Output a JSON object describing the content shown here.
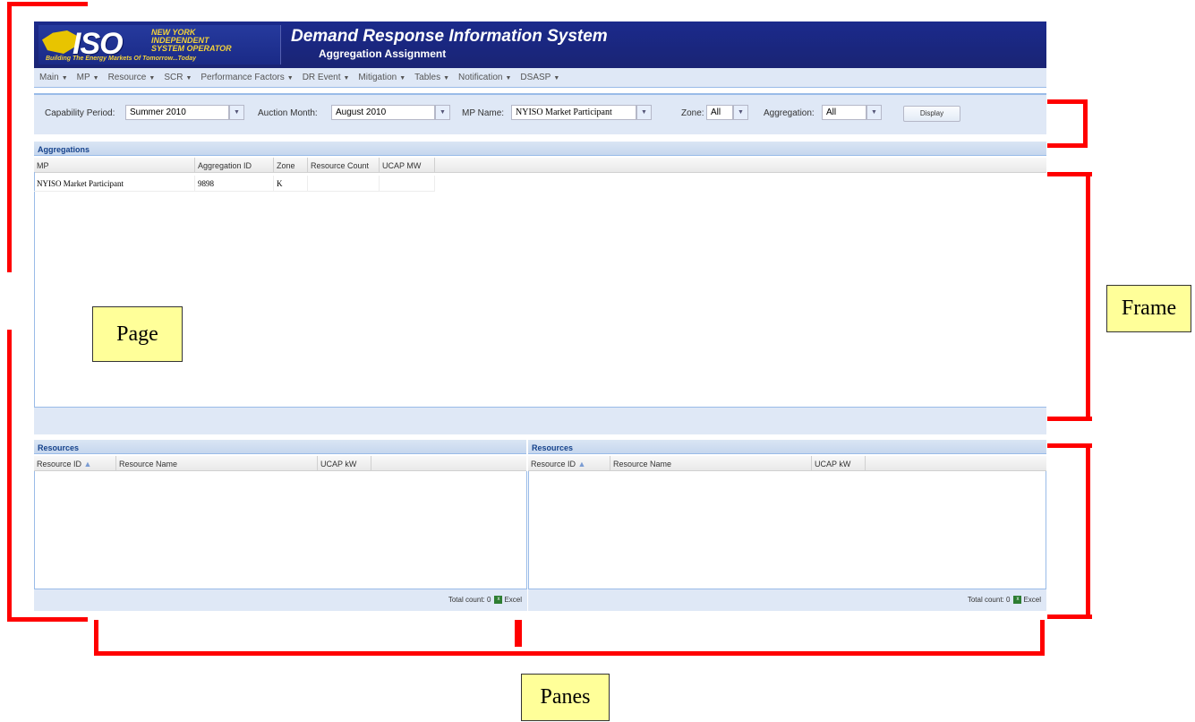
{
  "header": {
    "logo_text": "ISO",
    "logo_lines": "NEW YORK\nINDEPENDENT\nSYSTEM OPERATOR",
    "logo_tagline": "Building The Energy Markets Of Tomorrow...Today",
    "title": "Demand Response Information System",
    "subtitle": "Aggregation Assignment"
  },
  "menu": [
    "Main",
    "MP",
    "Resource",
    "SCR",
    "Performance Factors",
    "DR Event",
    "Mitigation",
    "Tables",
    "Notification",
    "DSASP"
  ],
  "filters": {
    "capability_period_label": "Capability Period:",
    "capability_period_value": "Summer 2010",
    "auction_month_label": "Auction Month:",
    "auction_month_value": "August 2010",
    "mp_name_label": "MP Name:",
    "mp_name_value": "NYISO Market Participant",
    "zone_label": "Zone:",
    "zone_value": "All",
    "aggregation_label": "Aggregation:",
    "aggregation_value": "All",
    "display_button": "Display"
  },
  "aggregations": {
    "title": "Aggregations",
    "columns": [
      "MP",
      "Aggregation ID",
      "Zone",
      "Resource Count",
      "UCAP MW"
    ],
    "rows": [
      [
        "NYISO Market Participant",
        "9898",
        "K",
        "",
        ""
      ]
    ]
  },
  "resources_left": {
    "title": "Resources",
    "columns": [
      "Resource ID",
      "Resource Name",
      "UCAP kW"
    ],
    "footer_count": "Total count: 0",
    "excel_label": "Excel"
  },
  "resources_right": {
    "title": "Resources",
    "columns": [
      "Resource ID",
      "Resource Name",
      "UCAP kW"
    ],
    "footer_count": "Total count: 0",
    "excel_label": "Excel"
  },
  "annotations": {
    "page": "Page",
    "frame": "Frame",
    "panes": "Panes"
  },
  "colors": {
    "header_blue": "#1a2474",
    "panel_blue": "#dfe8f6",
    "annotation_red": "#ff0000",
    "callout_yellow": "#ffff99"
  }
}
